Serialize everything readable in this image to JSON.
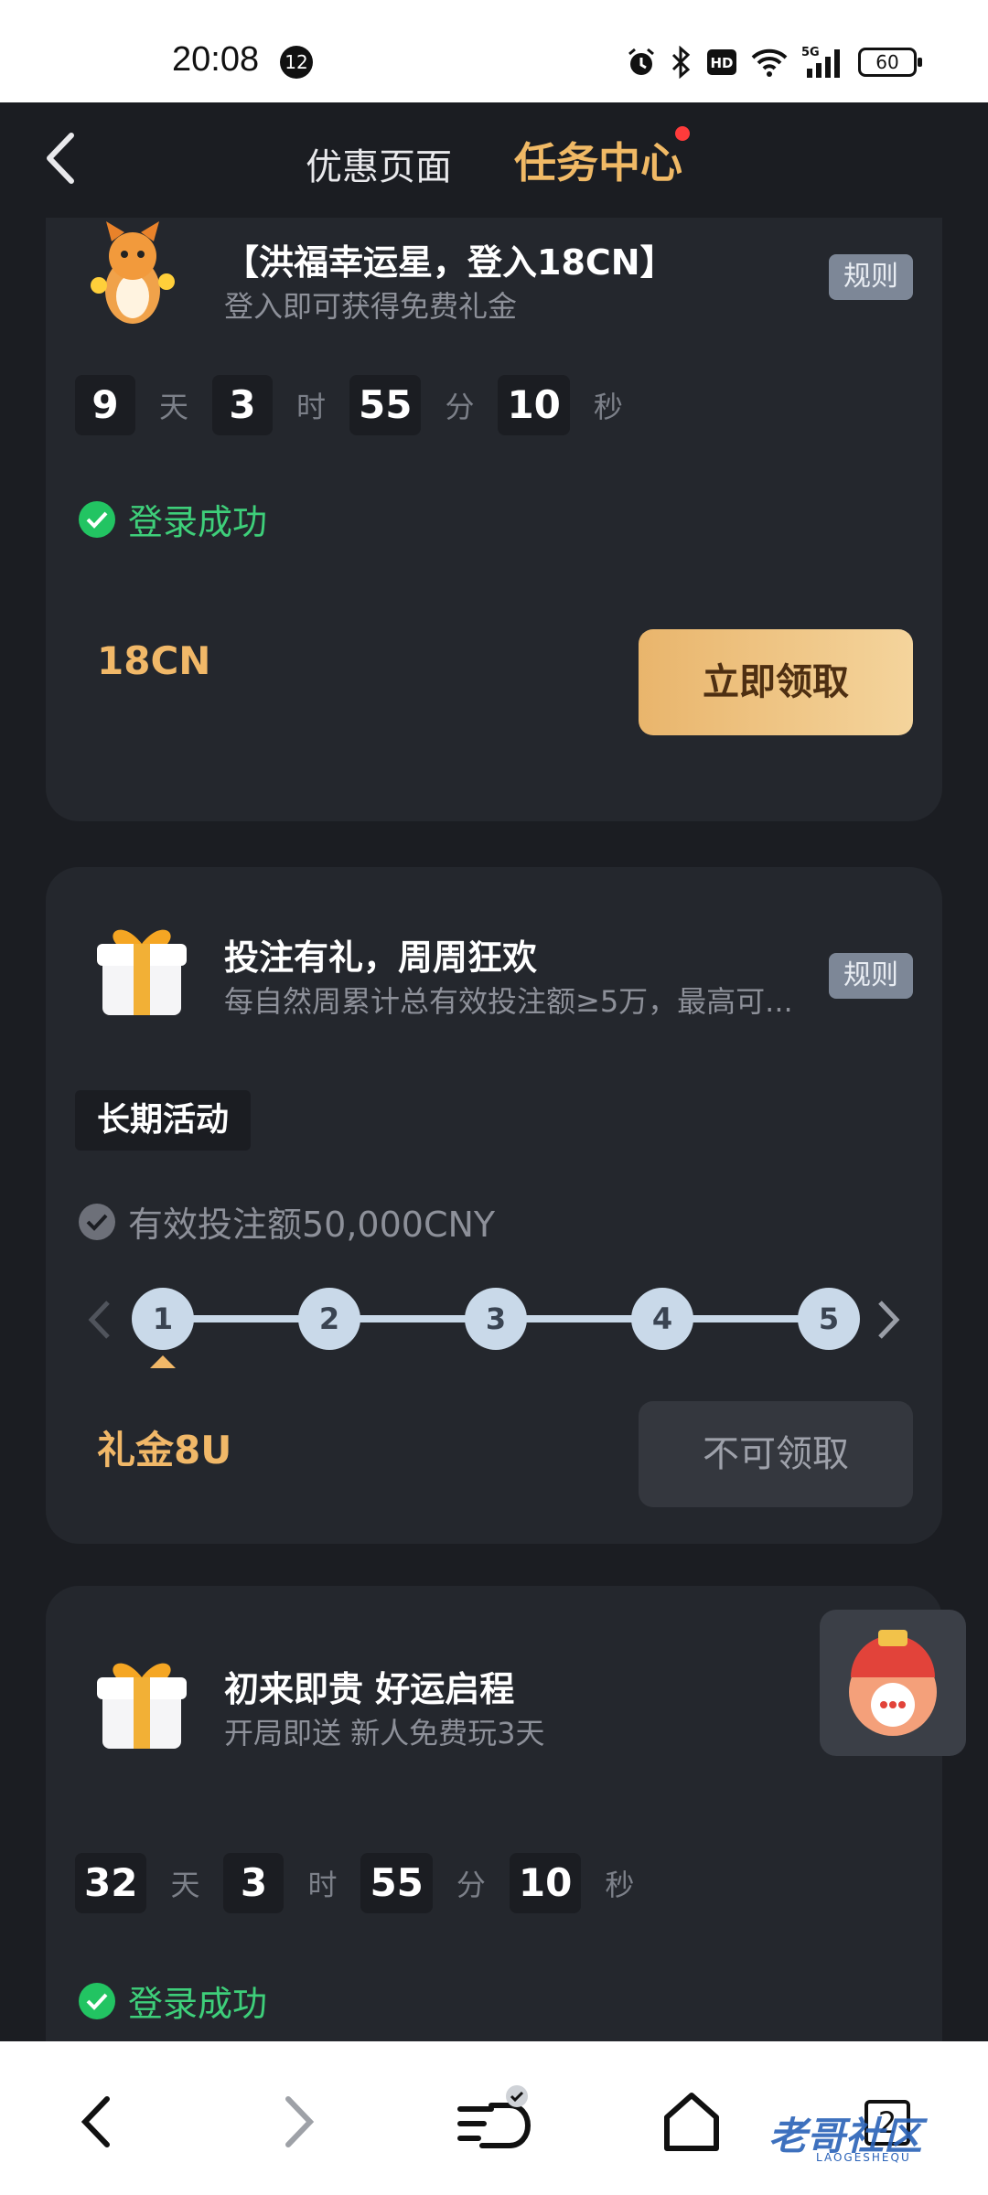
{
  "status_bar": {
    "time": "20:08",
    "notif_count": "12",
    "net": "5G",
    "battery": "60"
  },
  "header": {
    "back": "back",
    "tab_promo": "优惠页面",
    "tab_task": "任务中心"
  },
  "cards": [
    {
      "title": "【洪福幸运星，登入18CN】",
      "subtitle": "登入即可获得免费礼金",
      "rule": "规则",
      "countdown": {
        "d": "9",
        "d_unit": "天",
        "h": "3",
        "h_unit": "时",
        "m": "55",
        "m_unit": "分",
        "s": "10",
        "s_unit": "秒"
      },
      "status": "登录成功",
      "reward": "18CN",
      "button": "立即领取"
    },
    {
      "title": "投注有礼，周周狂欢",
      "subtitle": "每自然周累计总有效投注额≥5万，最高可...",
      "rule": "规则",
      "tag": "长期活动",
      "condition": "有效投注额50,000CNY",
      "steps": [
        "1",
        "2",
        "3",
        "4",
        "5"
      ],
      "reward": "礼金8U",
      "button": "不可领取"
    },
    {
      "title": "初来即贵 好运启程",
      "subtitle": "开局即送 新人免费玩3天",
      "countdown": {
        "d": "32",
        "d_unit": "天",
        "h": "3",
        "h_unit": "时",
        "m": "55",
        "m_unit": "分",
        "s": "10",
        "s_unit": "秒"
      },
      "status": "登录成功"
    }
  ],
  "bottom_nav": {
    "tab_count": "2",
    "watermark": "老哥社区",
    "watermark_sub": "LAOGESHEQU"
  },
  "colors": {
    "accent": "#f0b965",
    "success": "#3ecf7a",
    "card_bg": "#24272d",
    "page_bg": "#1b1d22"
  }
}
